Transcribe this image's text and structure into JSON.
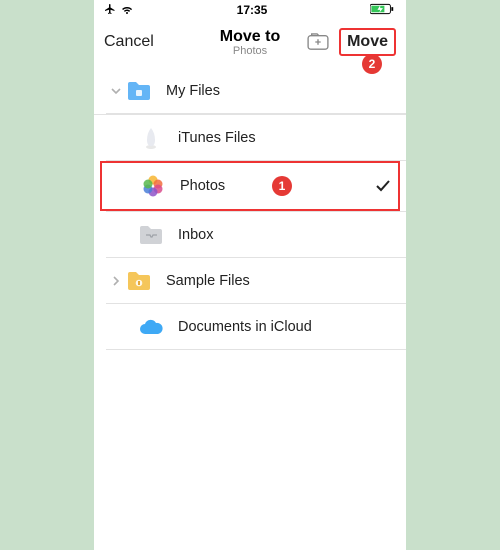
{
  "statusbar": {
    "time": "17:35"
  },
  "header": {
    "cancel": "Cancel",
    "title": "Move to",
    "subtitle": "Photos",
    "move": "Move"
  },
  "annotations": {
    "step1": "1",
    "step2": "2"
  },
  "rows": {
    "myfiles": "My Files",
    "itunes": "iTunes Files",
    "photos": "Photos",
    "inbox": "Inbox",
    "sample": "Sample Files",
    "icloud": "Documents in iCloud"
  }
}
